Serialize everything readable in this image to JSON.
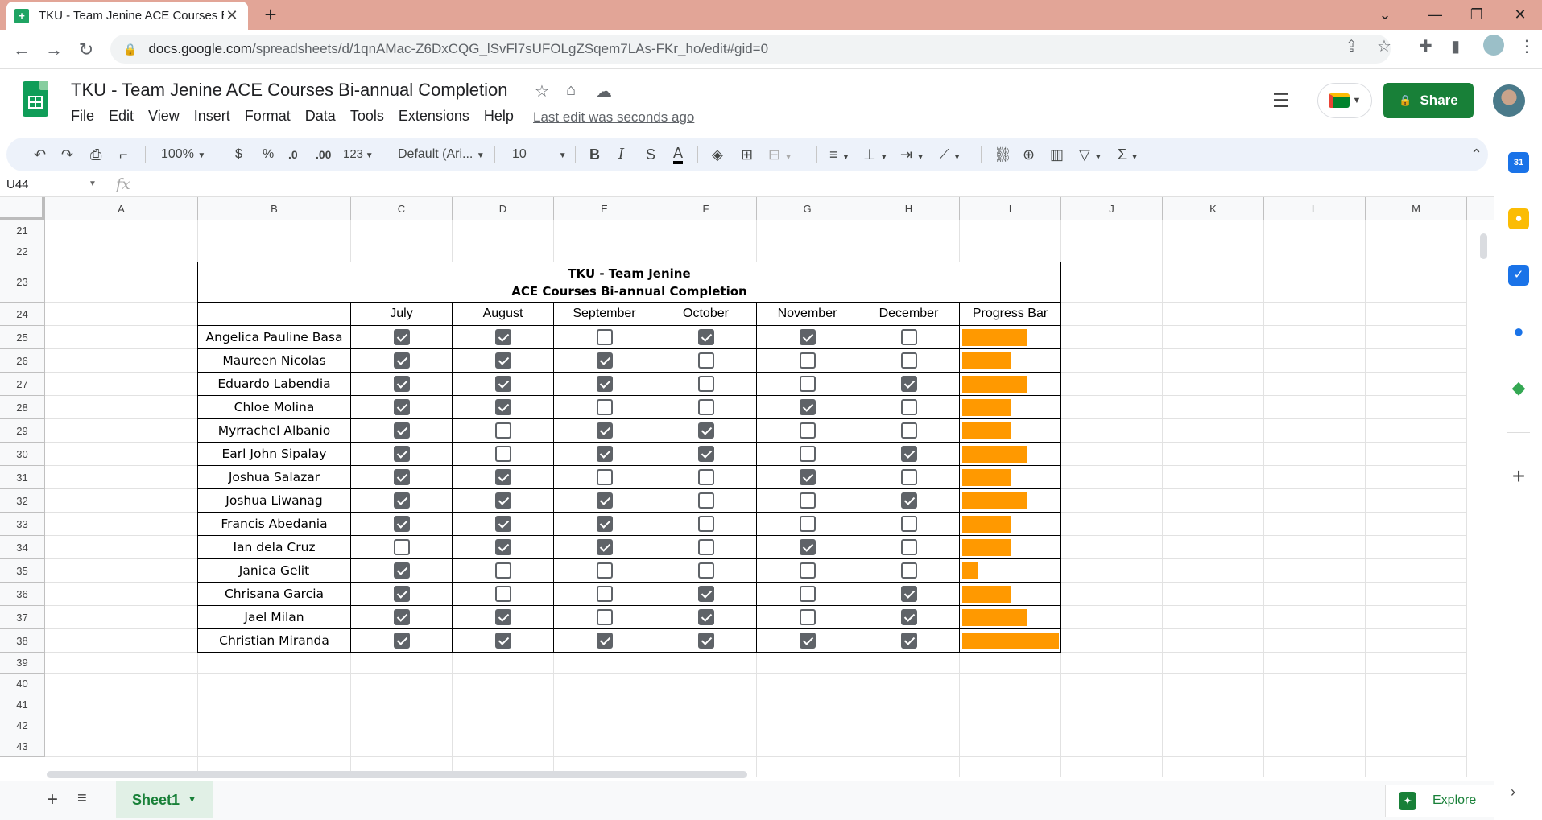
{
  "browser": {
    "tab_title": "TKU - Team Jenine ACE Courses B",
    "new_tab": "+",
    "url_host": "docs.google.com",
    "url_path": "/spreadsheets/d/1qnAMac-Z6DxCQG_lSvFl7sUFOLgZSqem7LAs-FKr_ho/edit#gid=0"
  },
  "doc": {
    "title": "TKU - Team Jenine  ACE Courses Bi-annual Completion",
    "menu": [
      "File",
      "Edit",
      "View",
      "Insert",
      "Format",
      "Data",
      "Tools",
      "Extensions",
      "Help"
    ],
    "last_edit": "Last edit was seconds ago",
    "share_label": "Share"
  },
  "toolbar": {
    "zoom": "100%",
    "currency": "$",
    "percent": "%",
    "dec_decrease": ".0",
    "dec_increase": ".00",
    "more_formats": "123",
    "font": "Default (Ari...",
    "font_size": "10",
    "bold": "B",
    "italic": "I",
    "strike": "S",
    "text_color": "A"
  },
  "formula_bar": {
    "name_box": "U44",
    "fx": "fx"
  },
  "grid": {
    "columns": [
      "A",
      "B",
      "C",
      "D",
      "E",
      "F",
      "G",
      "H",
      "I",
      "J",
      "K",
      "L",
      "M"
    ],
    "rows": [
      "21",
      "22",
      "23",
      "24",
      "25",
      "26",
      "27",
      "28",
      "29",
      "30",
      "31",
      "32",
      "33",
      "34",
      "35",
      "36",
      "37",
      "38",
      "39",
      "40",
      "41",
      "42",
      "43"
    ]
  },
  "table": {
    "title_line1": "TKU - Team Jenine",
    "title_line2": "ACE Courses Bi-annual Completion",
    "months": [
      "July",
      "August",
      "September",
      "October",
      "November",
      "December"
    ],
    "progress_header": "Progress Bar",
    "progress_color": "#ff9900",
    "people": [
      {
        "name": "Angelica Pauline Basa",
        "checks": [
          true,
          true,
          false,
          true,
          true,
          false
        ],
        "progress": 0.6667
      },
      {
        "name": "Maureen Nicolas",
        "checks": [
          true,
          true,
          true,
          false,
          false,
          false
        ],
        "progress": 0.5
      },
      {
        "name": "Eduardo Labendia",
        "checks": [
          true,
          true,
          true,
          false,
          false,
          true
        ],
        "progress": 0.6667
      },
      {
        "name": "Chloe Molina",
        "checks": [
          true,
          true,
          false,
          false,
          true,
          false
        ],
        "progress": 0.5
      },
      {
        "name": "Myrrachel Albanio",
        "checks": [
          true,
          false,
          true,
          true,
          false,
          false
        ],
        "progress": 0.5
      },
      {
        "name": "Earl John Sipalay",
        "checks": [
          true,
          false,
          true,
          true,
          false,
          true
        ],
        "progress": 0.6667
      },
      {
        "name": "Joshua Salazar",
        "checks": [
          true,
          true,
          false,
          false,
          true,
          false
        ],
        "progress": 0.5
      },
      {
        "name": "Joshua Liwanag",
        "checks": [
          true,
          true,
          true,
          false,
          false,
          true
        ],
        "progress": 0.6667
      },
      {
        "name": "Francis Abedania",
        "checks": [
          true,
          true,
          true,
          false,
          false,
          false
        ],
        "progress": 0.5
      },
      {
        "name": "Ian dela Cruz",
        "checks": [
          false,
          true,
          true,
          false,
          true,
          false
        ],
        "progress": 0.5
      },
      {
        "name": "Janica Gelit",
        "checks": [
          true,
          false,
          false,
          false,
          false,
          false
        ],
        "progress": 0.1667
      },
      {
        "name": "Chrisana Garcia",
        "checks": [
          true,
          false,
          false,
          true,
          false,
          true
        ],
        "progress": 0.5
      },
      {
        "name": "Jael Milan",
        "checks": [
          true,
          true,
          false,
          true,
          false,
          true
        ],
        "progress": 0.6667
      },
      {
        "name": "Christian Miranda",
        "checks": [
          true,
          true,
          true,
          true,
          true,
          true
        ],
        "progress": 1.0
      }
    ]
  },
  "bottom": {
    "sheet_tab": "Sheet1",
    "explore": "Explore",
    "add_sheet": "+"
  }
}
